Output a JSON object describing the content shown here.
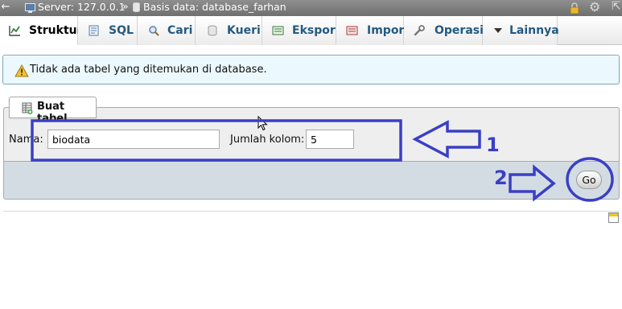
{
  "breadcrumb": {
    "back_arrow": "←",
    "server_text": "Server: 127.0.0.1",
    "separator": "»",
    "db_text": "Basis data: database_farhan",
    "icons": [
      "server-icon",
      "database-icon",
      "lock-icon",
      "gear-icon",
      "collapse-icon"
    ]
  },
  "tabs": [
    {
      "label": "Struktur",
      "icon": "structure-icon",
      "active": true
    },
    {
      "label": "SQL",
      "icon": "sql-icon",
      "active": false
    },
    {
      "label": "Cari",
      "icon": "search-icon",
      "active": false
    },
    {
      "label": "Kueri",
      "icon": "query-icon",
      "active": false
    },
    {
      "label": "Ekspor",
      "icon": "export-icon",
      "active": false
    },
    {
      "label": "Impor",
      "icon": "import-icon",
      "active": false
    },
    {
      "label": "Operasi",
      "icon": "wrench-icon",
      "active": false
    },
    {
      "label": "Lainnya",
      "icon": "caret-down-icon",
      "active": false
    }
  ],
  "notice": {
    "icon": "warning-icon",
    "message": "Tidak ada tabel yang ditemukan di database."
  },
  "create_table": {
    "legend": "Buat tabel",
    "name_label": "Nama:",
    "name_value": "biodata",
    "columns_label": "Jumlah kolom:",
    "columns_value": "5",
    "go_label": "Go"
  },
  "annotations": {
    "step1": "1",
    "step2": "2",
    "color": "#3a3fc4"
  },
  "colors": {
    "tab_text": "#235a81",
    "notice_bg": "#ebf8fd",
    "footer_bg": "#d4dce3",
    "topbar_bg": "#7f7f7f"
  }
}
